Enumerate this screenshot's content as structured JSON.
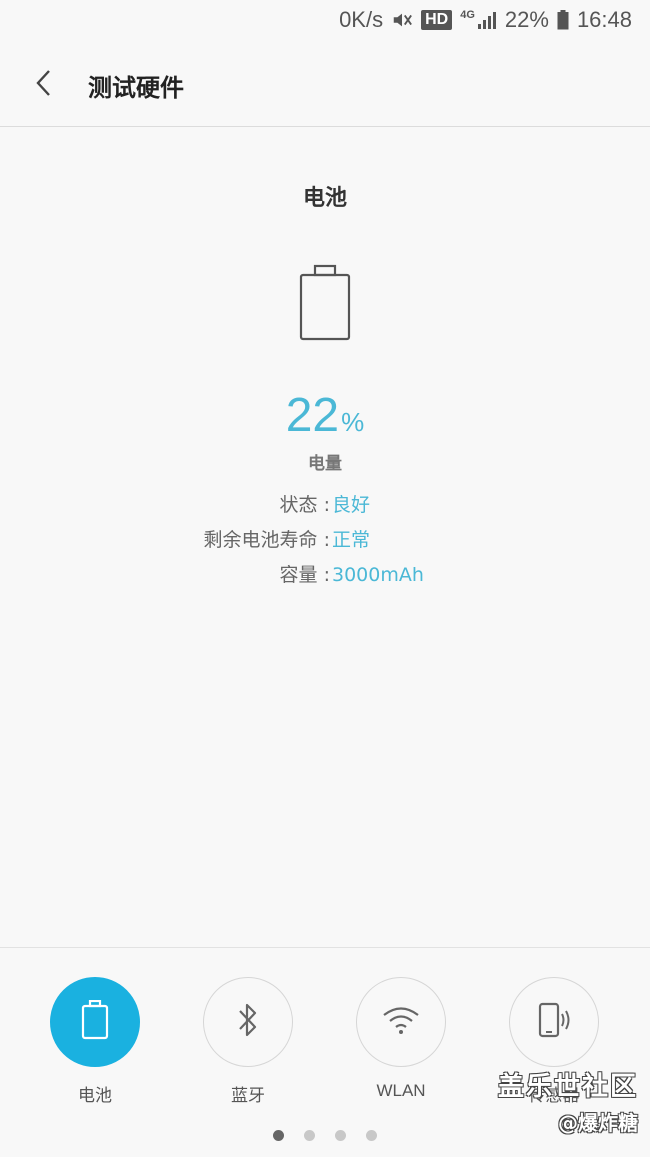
{
  "status_bar": {
    "speed": "0K/s",
    "mute_icon": "volume-mute-icon",
    "hd": "HD",
    "network": "4G",
    "signal_icon": "signal-icon",
    "battery_percent": "22%",
    "battery_icon": "battery-icon",
    "time": "16:48"
  },
  "app_bar": {
    "back_icon": "chevron-left-icon",
    "title": "测试硬件"
  },
  "battery": {
    "section_title": "电池",
    "icon": "battery-outline-icon",
    "level_value": "22",
    "level_unit": "%",
    "level_label": "电量",
    "info": [
      {
        "key": "状态 : ",
        "value": "良好"
      },
      {
        "key": "剩余电池寿命 : ",
        "value": "正常"
      },
      {
        "key": "容量 : ",
        "value": "3000mAh"
      }
    ]
  },
  "tabs": [
    {
      "label": "电池",
      "icon": "battery-icon",
      "active": true
    },
    {
      "label": "蓝牙",
      "icon": "bluetooth-icon",
      "active": false
    },
    {
      "label": "WLAN",
      "icon": "wifi-icon",
      "active": false
    },
    {
      "label": "传感器",
      "icon": "phone-sensor-icon",
      "active": false
    }
  ],
  "pager": {
    "total": 4,
    "current": 1
  },
  "watermark": {
    "line1": "盖乐世社区",
    "line2": "@爆炸糖"
  },
  "colors": {
    "accent": "#4bb8d6",
    "active_tab": "#1ab1e0",
    "background": "#f8f8f8"
  }
}
